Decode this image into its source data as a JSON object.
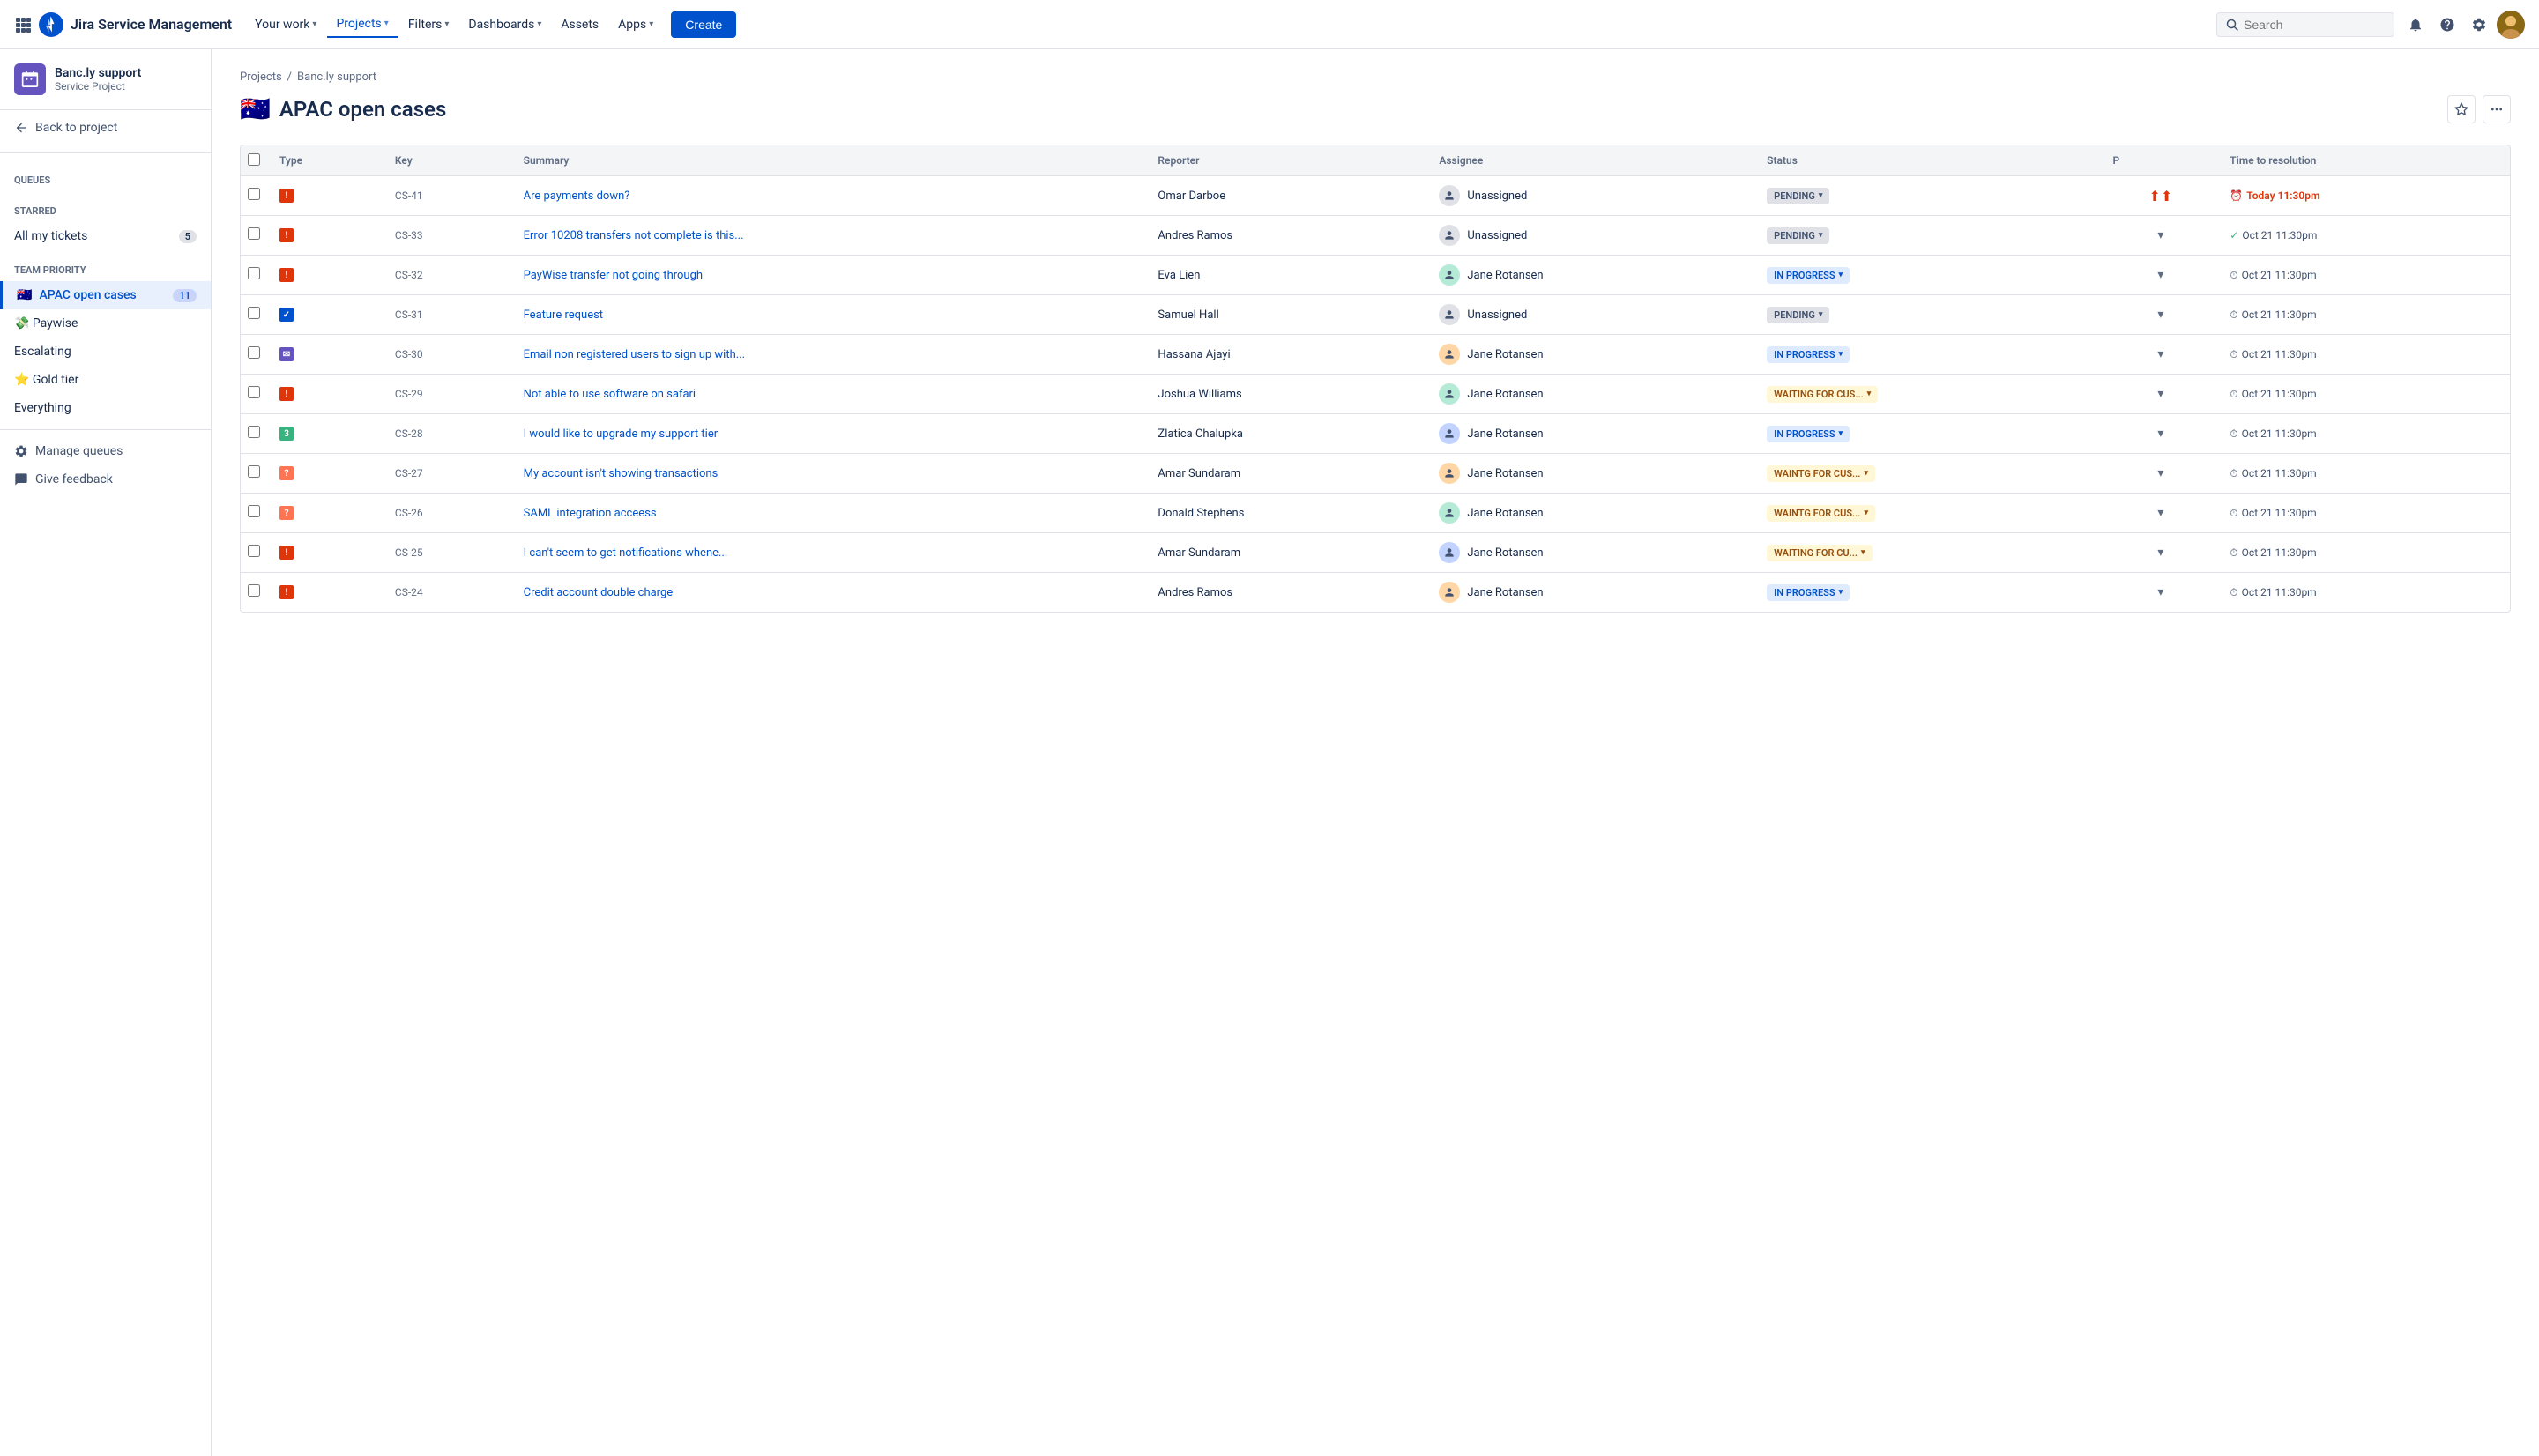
{
  "app": {
    "name": "Jira Service Management"
  },
  "nav": {
    "links": [
      {
        "id": "your-work",
        "label": "Your work",
        "hasChevron": true,
        "active": false
      },
      {
        "id": "projects",
        "label": "Projects",
        "hasChevron": true,
        "active": true
      },
      {
        "id": "filters",
        "label": "Filters",
        "hasChevron": true,
        "active": false
      },
      {
        "id": "dashboards",
        "label": "Dashboards",
        "hasChevron": true,
        "active": false
      },
      {
        "id": "assets",
        "label": "Assets",
        "hasChevron": false,
        "active": false
      },
      {
        "id": "apps",
        "label": "Apps",
        "hasChevron": true,
        "active": false
      }
    ],
    "create_label": "Create",
    "search_placeholder": "Search"
  },
  "sidebar": {
    "project_name": "Banc.ly support",
    "project_type": "Service Project",
    "back_label": "Back to project",
    "queues_label": "Queues",
    "starred_section": "Starred",
    "team_priority_section": "Team Priority",
    "all_tickets_label": "All my tickets",
    "all_tickets_count": "5",
    "apac_label": "APAC open cases",
    "apac_flag": "🇦🇺",
    "apac_count": "11",
    "paywise_label": "💸 Paywise",
    "escalating_label": "Escalating",
    "gold_tier_label": "⭐ Gold tier",
    "everything_label": "Everything",
    "manage_queues_label": "Manage queues",
    "give_feedback_label": "Give feedback"
  },
  "page": {
    "breadcrumb_projects": "Projects",
    "breadcrumb_sep": "/",
    "breadcrumb_current": "Banc.ly support",
    "title_flag": "🇦🇺",
    "title": "APAC open cases"
  },
  "table": {
    "columns": [
      "",
      "Type",
      "Key",
      "Summary",
      "Reporter",
      "Assignee",
      "Status",
      "P",
      "Time to resolution"
    ],
    "rows": [
      {
        "key": "CS-41",
        "type": "bug",
        "summary": "Are payments down?",
        "reporter": "Omar Darboe",
        "assignee": "Unassigned",
        "assignee_type": "unassigned",
        "status": "PENDING",
        "status_type": "pending",
        "priority": "high",
        "time": "Today 11:30pm",
        "time_type": "today"
      },
      {
        "key": "CS-33",
        "type": "bug",
        "summary": "Error 10208 transfers not complete is this...",
        "reporter": "Andres Ramos",
        "assignee": "Unassigned",
        "assignee_type": "unassigned",
        "status": "PENDING",
        "status_type": "pending",
        "priority": "med",
        "time": "Oct 21 11:30pm",
        "time_type": "check"
      },
      {
        "key": "CS-32",
        "type": "bug",
        "summary": "PayWise transfer not going through",
        "reporter": "Eva Lien",
        "assignee": "Jane Rotansen",
        "assignee_type": "assigned",
        "status": "IN PROGRESS",
        "status_type": "in-progress",
        "priority": "med",
        "time": "Oct 21 11:30pm",
        "time_type": "normal"
      },
      {
        "key": "CS-31",
        "type": "task",
        "summary": "Feature request",
        "reporter": "Samuel Hall",
        "assignee": "Unassigned",
        "assignee_type": "unassigned",
        "status": "PENDING",
        "status_type": "pending",
        "priority": "med",
        "time": "Oct 21 11:30pm",
        "time_type": "normal"
      },
      {
        "key": "CS-30",
        "type": "email",
        "summary": "Email non registered users to sign up with...",
        "reporter": "Hassana Ajayi",
        "assignee": "Jane Rotansen",
        "assignee_type": "assigned",
        "status": "IN PROGRESS",
        "status_type": "in-progress",
        "priority": "med",
        "time": "Oct 21 11:30pm",
        "time_type": "normal"
      },
      {
        "key": "CS-29",
        "type": "bug",
        "summary": "Not able to use software on safari",
        "reporter": "Joshua Williams",
        "assignee": "Jane Rotansen",
        "assignee_type": "assigned",
        "status": "WAITING FOR CUS...",
        "status_type": "waiting",
        "priority": "med",
        "time": "Oct 21 11:30pm",
        "time_type": "normal"
      },
      {
        "key": "CS-28",
        "type": "story",
        "summary": "I would like to upgrade my support tier",
        "reporter": "Zlatica Chalupka",
        "assignee": "Jane Rotansen",
        "assignee_type": "assigned",
        "status": "IN PROGRESS",
        "status_type": "in-progress",
        "priority": "med",
        "time": "Oct 21 11:30pm",
        "time_type": "normal"
      },
      {
        "key": "CS-27",
        "type": "question",
        "summary": "My account isn't showing transactions",
        "reporter": "Amar Sundaram",
        "assignee": "Jane Rotansen",
        "assignee_type": "assigned",
        "status": "WAINTG FOR CUS...",
        "status_type": "waiting",
        "priority": "med",
        "time": "Oct 21 11:30pm",
        "time_type": "normal"
      },
      {
        "key": "CS-26",
        "type": "question",
        "summary": "SAML integration acceess",
        "reporter": "Donald Stephens",
        "assignee": "Jane Rotansen",
        "assignee_type": "assigned",
        "status": "WAINTG FOR CUS...",
        "status_type": "waiting",
        "priority": "med",
        "time": "Oct 21 11:30pm",
        "time_type": "normal"
      },
      {
        "key": "CS-25",
        "type": "bug",
        "summary": "I can't seem to get notifications whene...",
        "reporter": "Amar Sundaram",
        "assignee": "Jane Rotansen",
        "assignee_type": "assigned",
        "status": "WAITING FOR CU...",
        "status_type": "waiting",
        "priority": "med",
        "time": "Oct 21 11:30pm",
        "time_type": "normal"
      },
      {
        "key": "CS-24",
        "type": "bug",
        "summary": "Credit account double charge",
        "reporter": "Andres Ramos",
        "assignee": "Jane Rotansen",
        "assignee_type": "assigned",
        "status": "IN PROGRESS",
        "status_type": "in-progress",
        "priority": "med",
        "time": "Oct 21 11:30pm",
        "time_type": "normal"
      }
    ]
  }
}
